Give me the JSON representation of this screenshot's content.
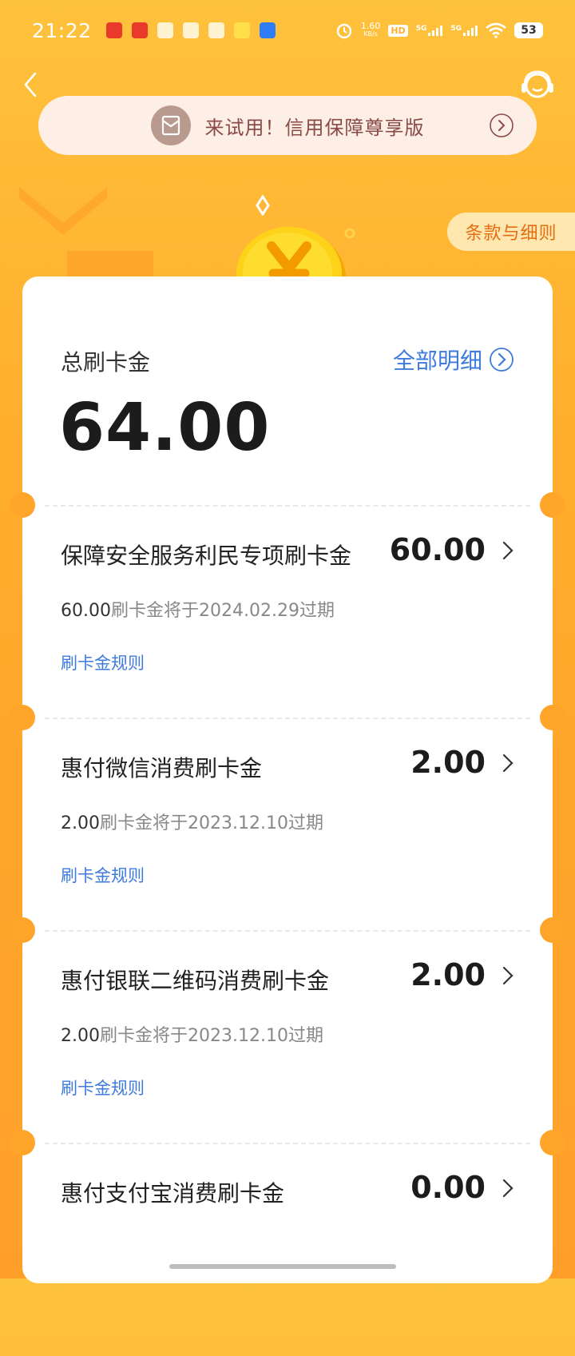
{
  "status_bar": {
    "time": "21:22",
    "net_speed": "1.60",
    "net_unit": "KB/s",
    "hd": "HD",
    "sim1": "5G",
    "sim2": "5G",
    "battery": "53"
  },
  "header": {
    "promo_text": "来试用！信用保障尊享版",
    "terms_label": "条款与细则"
  },
  "summary": {
    "label": "总刷卡金",
    "detail_link": "全部明细",
    "total": "64.00"
  },
  "items": [
    {
      "title": "保障安全服务利民专项刷卡金",
      "amount": "60.00",
      "expire_amount": "60.00",
      "expire_text": "刷卡金将于2024.02.29过期",
      "rule_label": "刷卡金规则"
    },
    {
      "title": "惠付微信消费刷卡金",
      "amount": "2.00",
      "expire_amount": "2.00",
      "expire_text": "刷卡金将于2023.12.10过期",
      "rule_label": "刷卡金规则"
    },
    {
      "title": "惠付银联二维码消费刷卡金",
      "amount": "2.00",
      "expire_amount": "2.00",
      "expire_text": "刷卡金将于2023.12.10过期",
      "rule_label": "刷卡金规则"
    },
    {
      "title": "惠付支付宝消费刷卡金",
      "amount": "0.00"
    }
  ],
  "colors": {
    "background": "#ffb02e",
    "link_blue": "#3e7bdc",
    "terms_orange": "#e56d12",
    "promo_text": "#8a4b48"
  }
}
